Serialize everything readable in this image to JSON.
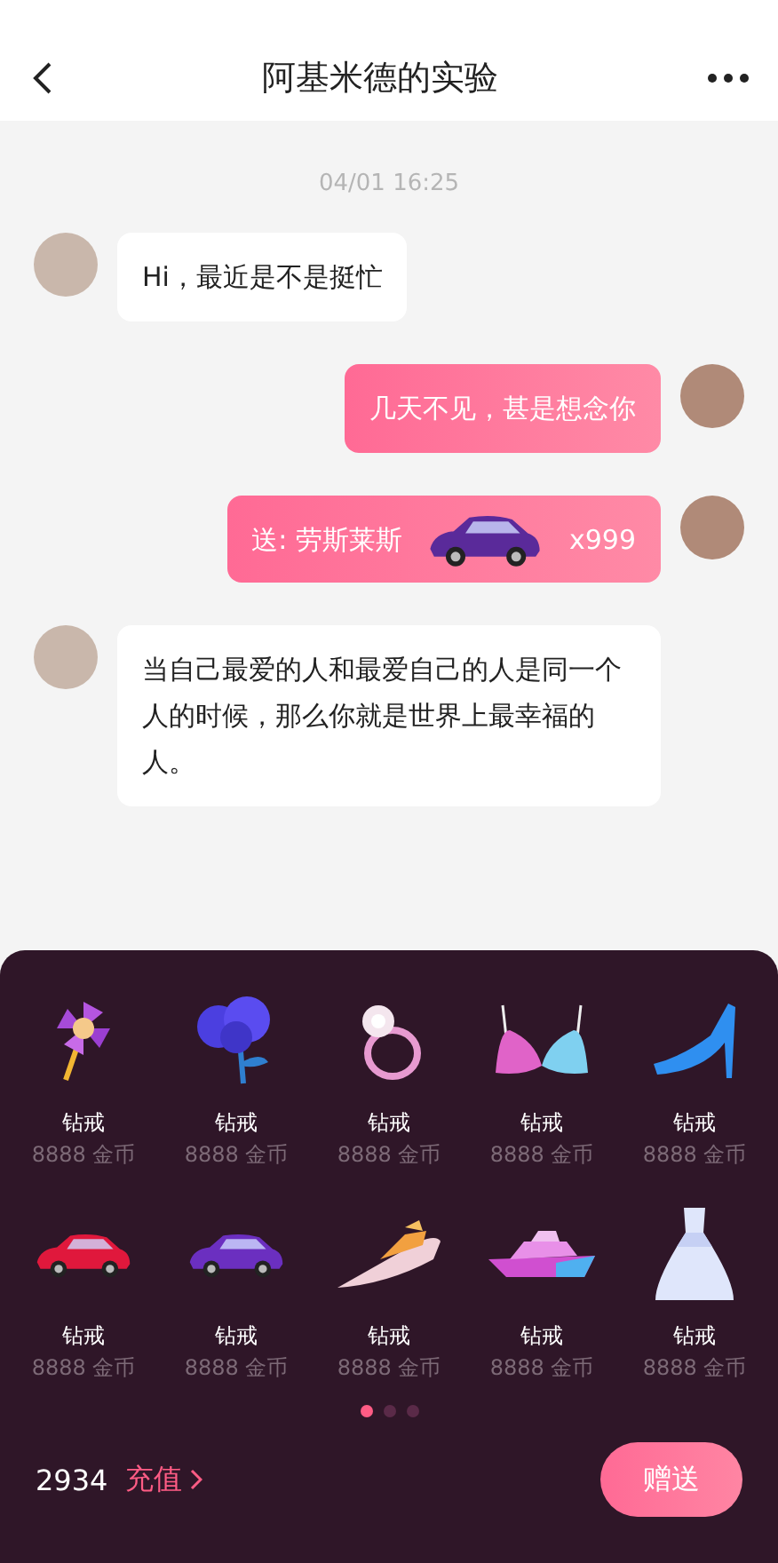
{
  "header": {
    "title": "阿基米德的实验"
  },
  "chat": {
    "timestamp": "04/01  16:25",
    "messages": [
      {
        "kind": "text",
        "outgoing": false,
        "text": "Hi，最近是不是挺忙"
      },
      {
        "kind": "text",
        "outgoing": true,
        "text": "几天不见，甚是想念你"
      },
      {
        "kind": "gift",
        "outgoing": true,
        "text": "送: 劳斯莱斯",
        "count": "x999"
      },
      {
        "kind": "text",
        "outgoing": false,
        "text": "当自己最爱的人和最爱自己的人是同一个人的时候，那么你就是世界上最幸福的人。"
      }
    ]
  },
  "gift_panel": {
    "gifts": [
      {
        "kind": "pinwheel",
        "name": "钻戒",
        "price": "8888 金币"
      },
      {
        "kind": "rose",
        "name": "钻戒",
        "price": "8888 金币"
      },
      {
        "kind": "ring",
        "name": "钻戒",
        "price": "8888 金币"
      },
      {
        "kind": "bra",
        "name": "钻戒",
        "price": "8888 金币"
      },
      {
        "kind": "heel",
        "name": "钻戒",
        "price": "8888 金币"
      },
      {
        "kind": "sportscar",
        "name": "钻戒",
        "price": "8888 金币"
      },
      {
        "kind": "limousine",
        "name": "钻戒",
        "price": "8888 金币"
      },
      {
        "kind": "speedboat",
        "name": "钻戒",
        "price": "8888 金币"
      },
      {
        "kind": "yacht",
        "name": "钻戒",
        "price": "8888 金币"
      },
      {
        "kind": "dress",
        "name": "钻戒",
        "price": "8888 金币"
      }
    ],
    "pages": [
      {
        "selected": true
      },
      {
        "selected": false
      },
      {
        "selected": false
      }
    ],
    "balance": "2934",
    "recharge": "充值",
    "send_button": "赠送"
  }
}
